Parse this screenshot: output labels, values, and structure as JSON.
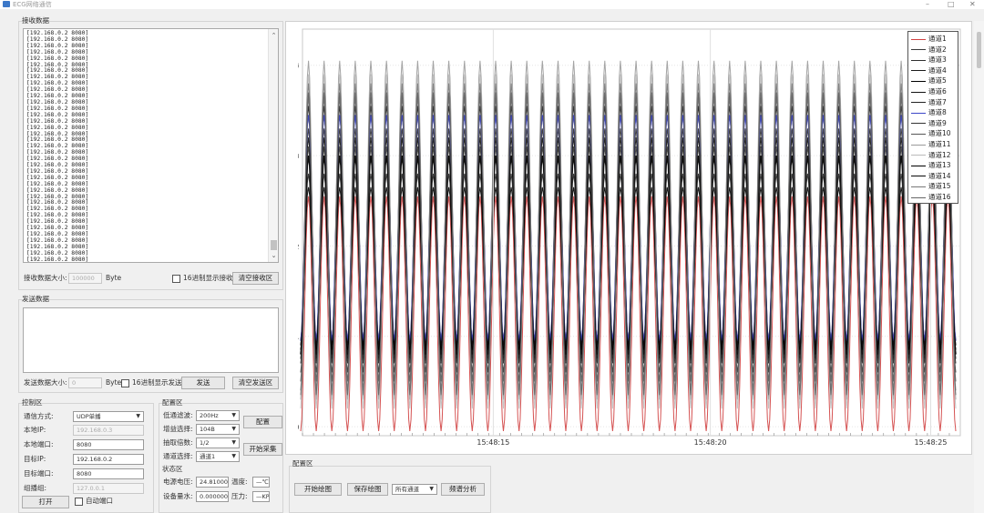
{
  "window": {
    "title": "ECG网络通信",
    "min": "–",
    "max": "□",
    "close": "✕"
  },
  "recv": {
    "group_title": "接收数据",
    "lines": [
      "[192.168.0.2 8080]",
      "[192.168.0.2 8080]",
      "[192.168.0.2 8080]",
      "[192.168.0.2 8080]",
      "[192.168.0.2 8080]",
      "[192.168.0.2 8080]",
      "[192.168.0.2 8080]",
      "[192.168.0.2 8080]",
      "[192.168.0.2 8080]",
      "[192.168.0.2 8080]",
      "[192.168.0.2 8080]",
      "[192.168.0.2 8080]",
      "[192.168.0.2 8080]",
      "[192.168.0.2 8080]",
      "[192.168.0.2 8080]",
      "[192.168.0.2 8080]",
      "[192.168.0.2 8080]",
      "[192.168.0.2 8080]",
      "[192.168.0.2 8080]",
      "[192.168.0.2 8080]",
      "[192.168.0.2 8080]",
      "[192.168.0.2 8080]",
      "[192.168.0.2 8080]",
      "[192.168.0.2 8080]",
      "[192.168.0.2 8080]",
      "[192.168.0.2 8080]",
      "[192.168.0.2 8080]",
      "[192.168.0.2 8080]",
      "[192.168.0.2 8080]",
      "[192.168.0.2 8080]",
      "[192.168.0.2 8080]",
      "[192.168.0.2 8080]",
      "[192.168.0.2 8080]",
      "[192.168.0.2 8080]",
      "[192.168.0.2 8080]",
      "[192.168.0.2 8080]",
      "[192.168.0.2 8080]"
    ],
    "size_label": "接收数据大小:",
    "size_value": "100000",
    "unit": "Byte",
    "hex_label": "16进制显示接收",
    "clear_button": "清空接收区"
  },
  "send": {
    "group_title": "发送数据",
    "size_label": "发送数据大小:",
    "size_value": "0",
    "unit": "Byte",
    "hex_label": "16进制显示发送",
    "send_button": "发送",
    "clear_button": "清空发送区"
  },
  "control": {
    "group_title": "控制区",
    "mode_label": "通信方式:",
    "mode_value": "UDP单播",
    "local_ip_label": "本地IP:",
    "local_ip_value": "192.168.0.3",
    "local_port_label": "本地端口:",
    "local_port_value": "8080",
    "target_ip_label": "目标IP:",
    "target_ip_value": "192.168.0.2",
    "target_port_label": "目标端口:",
    "target_port_value": "8080",
    "group_label": "组播组:",
    "group_value": "127.0.0.1",
    "open_button": "打开",
    "auto_port_label": "自动端口"
  },
  "config": {
    "group_title": "配置区",
    "lowpass_label": "低通滤波:",
    "lowpass_value": "200Hz",
    "gain_label": "增益选择:",
    "gain_value": "104B",
    "decim_label": "抽取倍数:",
    "decim_value": "1/2",
    "channel_label": "通道选择:",
    "channel_value": "通道1",
    "config_button": "配置",
    "start_collect_button": "开始采集",
    "status_title": "状态区",
    "voltage_label": "电源电压:",
    "voltage_value": "24.810000",
    "temp_label": "温度:",
    "temp_value": "—℃",
    "level_label": "设备量水:",
    "level_value": "0.000000",
    "pressure_label": "压力:",
    "pressure_value": "—KP"
  },
  "plot_config": {
    "group_title": "配置区",
    "start_plot_button": "开始绘图",
    "save_plot_button": "保存绘图",
    "channel_select": "所有通道",
    "spectrum_button": "频谱分析"
  },
  "chart_data": {
    "type": "line",
    "title": "",
    "xlabel": "",
    "ylabel": "",
    "ylim": [
      -0.1,
      4.4
    ],
    "y_ticks": [
      "0",
      "1",
      "2",
      "3",
      "4"
    ],
    "x_ticks": [
      "15:48:15",
      "15:48:20",
      "15:48:25"
    ],
    "grid": true,
    "legend_position": "top-right",
    "cycles": 42,
    "series": [
      {
        "name": "通道1",
        "color": "#d04040",
        "min": -0.05,
        "max": 2.55
      },
      {
        "name": "通道2",
        "color": "#3a3a3a",
        "min": 0.9,
        "max": 3.45
      },
      {
        "name": "通道3",
        "color": "#2f2f2f",
        "min": 0.85,
        "max": 3.3
      },
      {
        "name": "通道4",
        "color": "#1a1a1a",
        "min": 0.95,
        "max": 3.55
      },
      {
        "name": "通道5",
        "color": "#000000",
        "min": 0.8,
        "max": 3.0
      },
      {
        "name": "通道6",
        "color": "#111111",
        "min": 0.75,
        "max": 3.2
      },
      {
        "name": "通道7",
        "color": "#222222",
        "min": 0.7,
        "max": 2.8
      },
      {
        "name": "通道8",
        "color": "#3c46c8",
        "min": 0.95,
        "max": 3.45
      },
      {
        "name": "通道9",
        "color": "#333333",
        "min": 0.6,
        "max": 3.1
      },
      {
        "name": "通道10",
        "color": "#555555",
        "min": 0.5,
        "max": 3.7
      },
      {
        "name": "通道11",
        "color": "#9a9a9a",
        "min": 0.3,
        "max": 4.05
      },
      {
        "name": "通道12",
        "color": "#bbbbbb",
        "min": 0.2,
        "max": 3.9
      },
      {
        "name": "通道13",
        "color": "#000000",
        "min": 0.85,
        "max": 2.65
      },
      {
        "name": "通道14",
        "color": "#0a0a0a",
        "min": 0.9,
        "max": 3.0
      },
      {
        "name": "通道15",
        "color": "#777777",
        "min": 0.4,
        "max": 3.8
      },
      {
        "name": "通道16",
        "color": "#666666",
        "min": 0.35,
        "max": 3.65
      }
    ]
  }
}
